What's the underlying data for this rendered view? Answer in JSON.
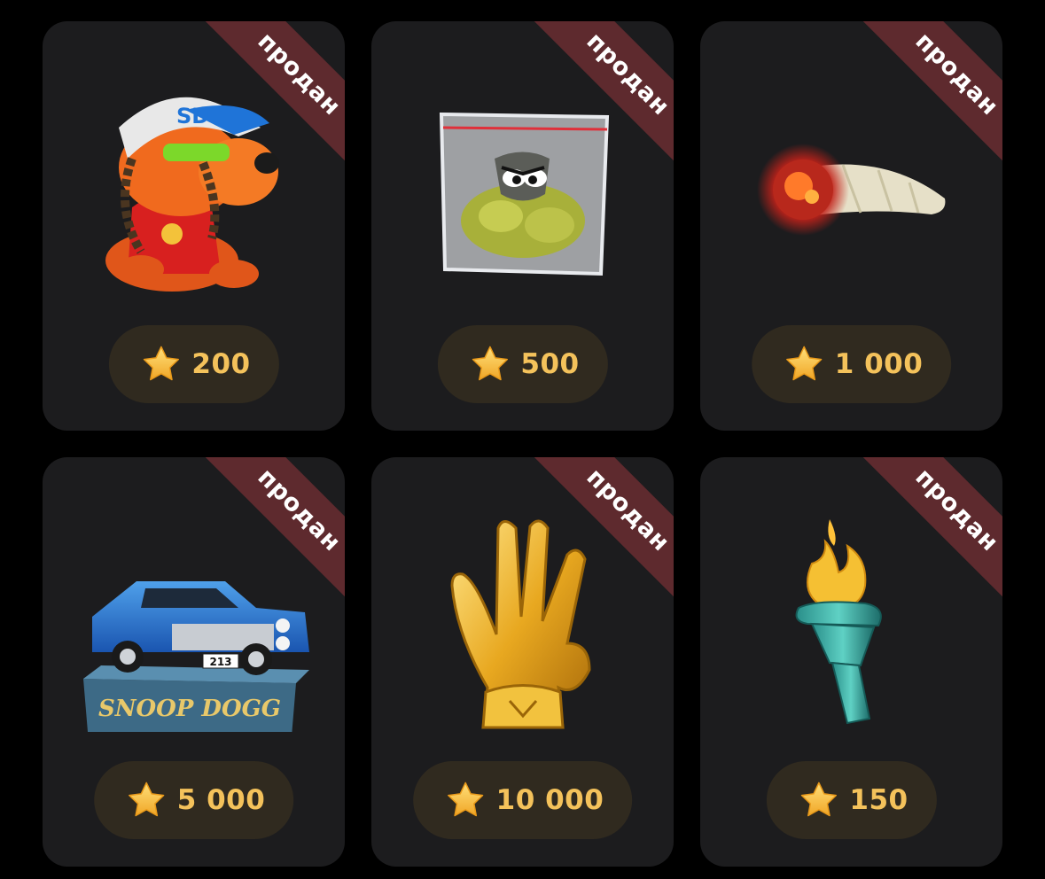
{
  "colors": {
    "background": "#000000",
    "card": "#1c1c1e",
    "ribbon": "#5e2a2e",
    "price_pill": "#302a1f",
    "price_text": "#f4c25b",
    "star": "#f6b93b"
  },
  "star_icon": "star-icon",
  "gifts": [
    {
      "icon": "dog-rapper-icon",
      "badge": "продан",
      "price": "200"
    },
    {
      "icon": "plastic-bag-icon",
      "badge": "продан",
      "price": "500"
    },
    {
      "icon": "joint-icon",
      "badge": "продан",
      "price": "1 000"
    },
    {
      "icon": "lowrider-car-icon",
      "badge": "продан",
      "price": "5 000",
      "plate": "213",
      "brand": "SNOOP DOGG"
    },
    {
      "icon": "golden-hand-icon",
      "badge": "продан",
      "price": "10 000"
    },
    {
      "icon": "torch-icon",
      "badge": "продан",
      "price": "150"
    }
  ]
}
